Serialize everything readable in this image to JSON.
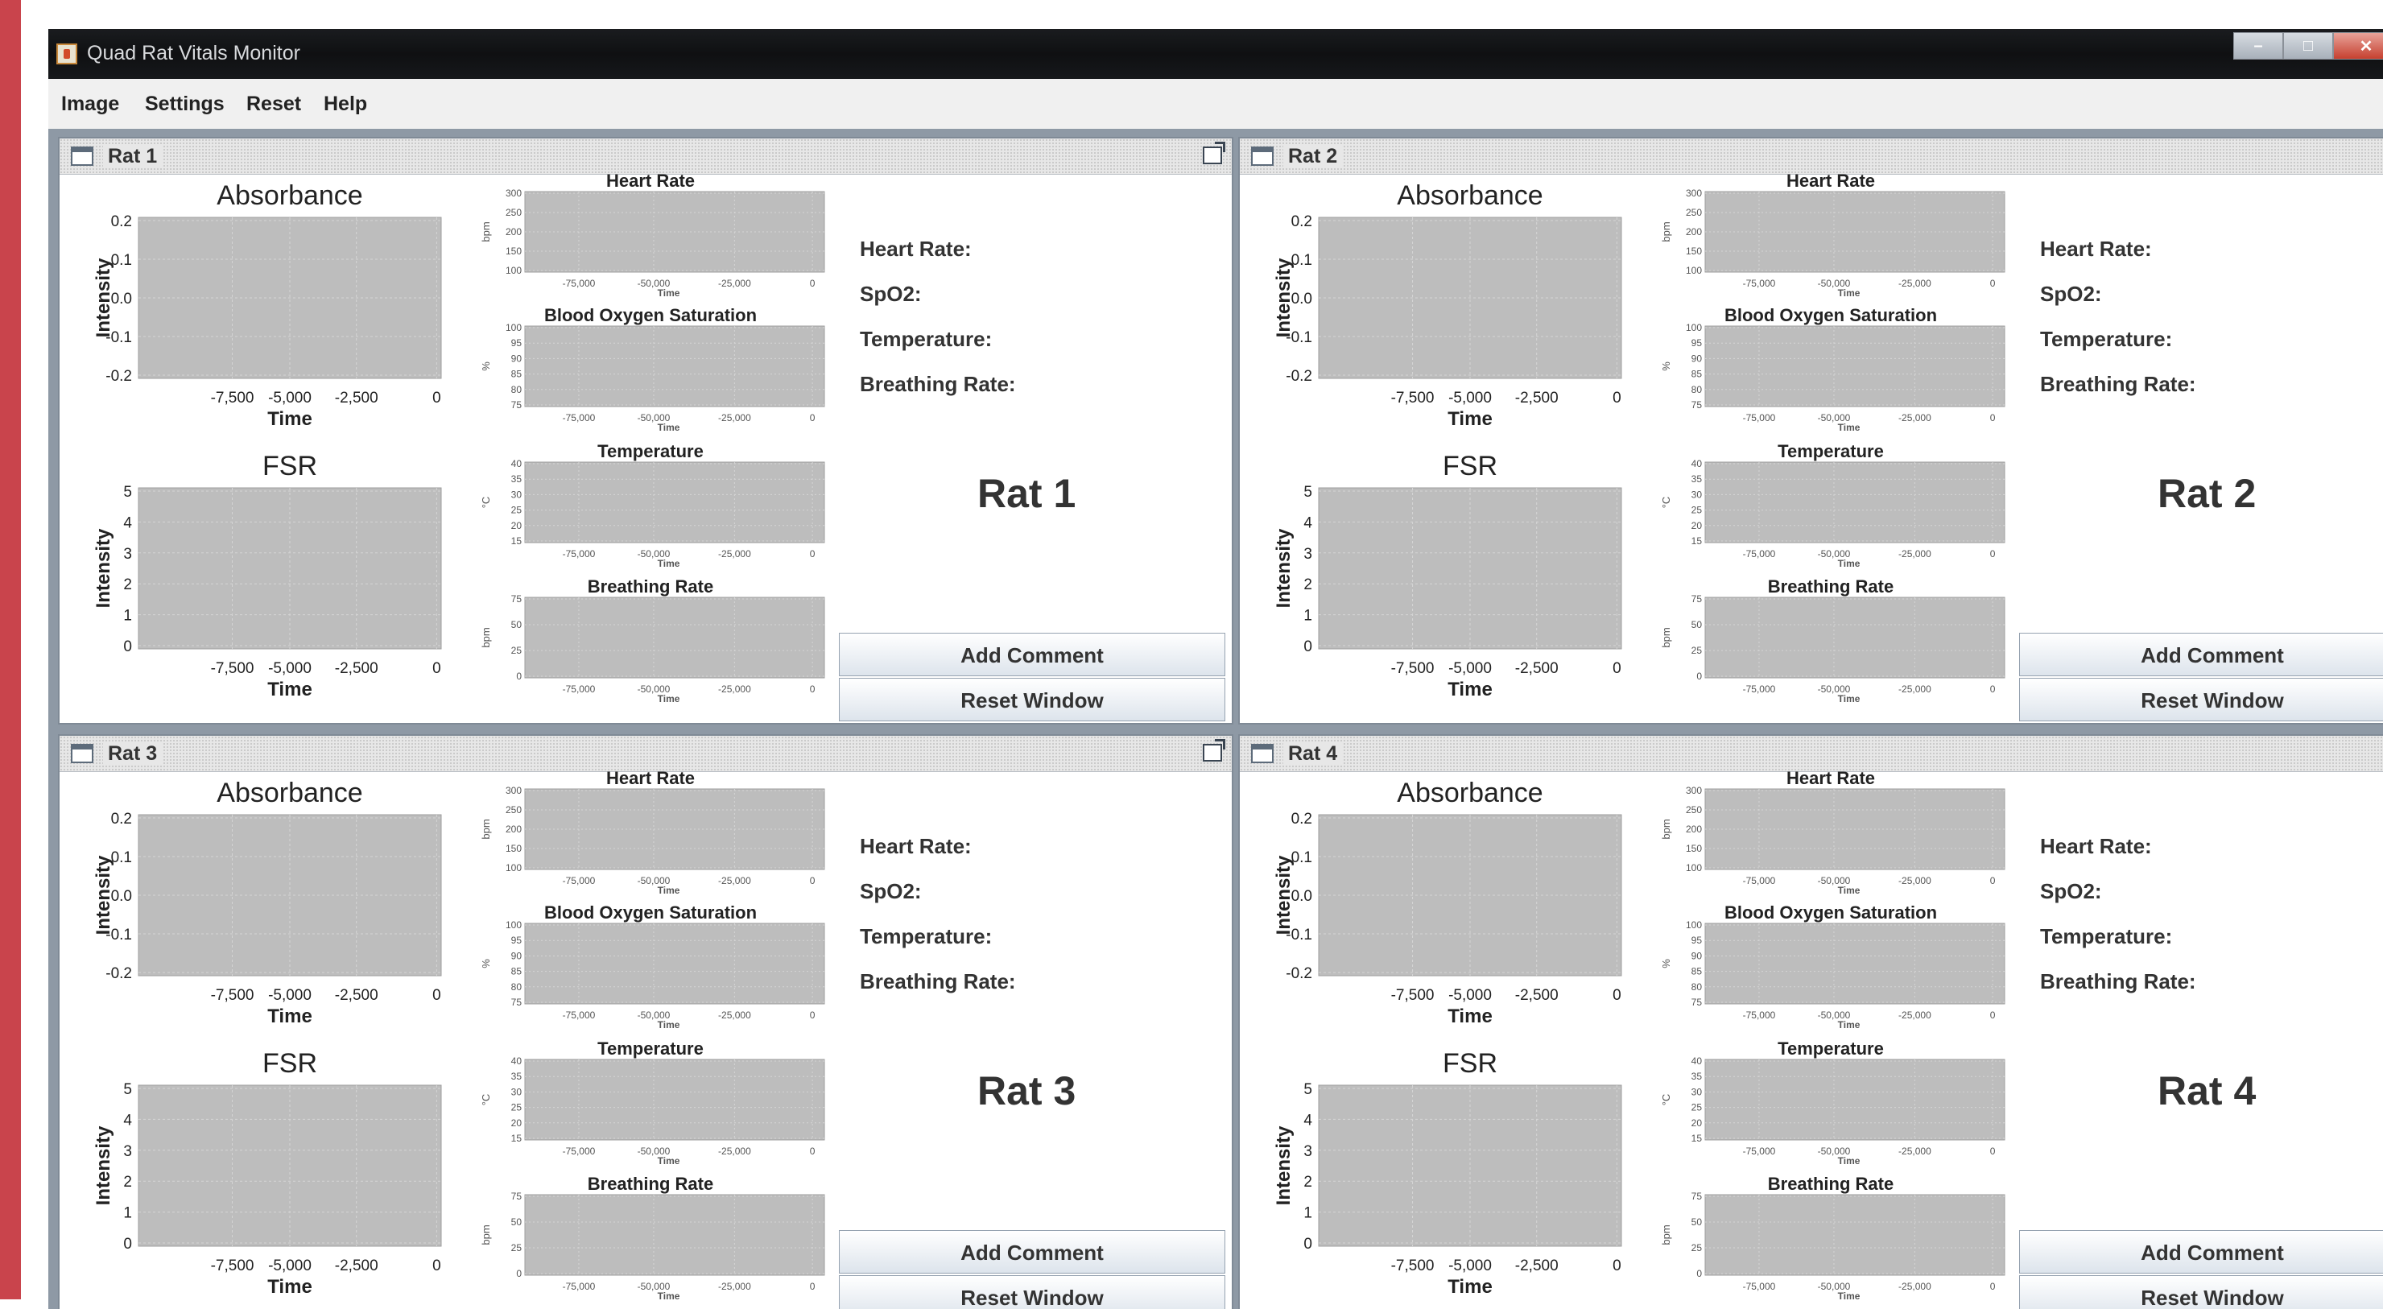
{
  "window": {
    "title": "Quad Rat Vitals Monitor"
  },
  "menu": [
    "Image",
    "Settings",
    "Reset",
    "Help"
  ],
  "panels": [
    {
      "tab": "Rat 1",
      "name": "Rat 1"
    },
    {
      "tab": "Rat 2",
      "name": "Rat 2"
    },
    {
      "tab": "Rat 3",
      "name": "Rat 3"
    },
    {
      "tab": "Rat 4",
      "name": "Rat 4"
    }
  ],
  "vitals_labels": [
    "Heart Rate:",
    "SpO2:",
    "Temperature:",
    "Breathing Rate:"
  ],
  "buttons": {
    "add_comment": "Add Comment",
    "reset_window": "Reset Window"
  },
  "colors": {
    "plot_bg": "#bdbdbd",
    "grid": "#d5d5d5",
    "desktop": "#8e99a5",
    "titlebar": "#131517"
  },
  "chart_data": {
    "absorbance": {
      "type": "line",
      "title": "Absorbance",
      "xlabel": "Time",
      "ylabel": "Intensity",
      "xticks": [
        "-7,500",
        "-5,000",
        "-2,500",
        "0"
      ],
      "yticks": [
        "0.2",
        "0.1",
        "0.0",
        "-0.1",
        "-0.2"
      ],
      "ylim": [
        -0.2,
        0.2
      ],
      "series": []
    },
    "fsr": {
      "type": "line",
      "title": "FSR",
      "xlabel": "Time",
      "ylabel": "Intensity",
      "xticks": [
        "-7,500",
        "-5,000",
        "-2,500",
        "0"
      ],
      "yticks": [
        "5",
        "4",
        "3",
        "2",
        "1",
        "0"
      ],
      "ylim": [
        0,
        5
      ],
      "series": []
    },
    "heart_rate": {
      "type": "line",
      "title": "Heart Rate",
      "xlabel": "Time",
      "ylabel": "bpm",
      "xticks": [
        "-75,000",
        "-50,000",
        "-25,000",
        "0"
      ],
      "yticks": [
        "300",
        "250",
        "200",
        "150",
        "100"
      ],
      "ylim": [
        100,
        300
      ],
      "series": []
    },
    "spo2": {
      "type": "line",
      "title": "Blood Oxygen Saturation",
      "xlabel": "Time",
      "ylabel": "%",
      "xticks": [
        "-75,000",
        "-50,000",
        "-25,000",
        "0"
      ],
      "yticks": [
        "100",
        "95",
        "90",
        "85",
        "80",
        "75"
      ],
      "ylim": [
        75,
        100
      ],
      "series": []
    },
    "temperature": {
      "type": "line",
      "title": "Temperature",
      "xlabel": "Time",
      "ylabel": "°C",
      "xticks": [
        "-75,000",
        "-50,000",
        "-25,000",
        "0"
      ],
      "yticks": [
        "40",
        "35",
        "30",
        "25",
        "20",
        "15"
      ],
      "ylim": [
        15,
        40
      ],
      "series": []
    },
    "breathing_rate": {
      "type": "line",
      "title": "Breathing Rate",
      "xlabel": "Time",
      "ylabel": "bpm",
      "xticks": [
        "-75,000",
        "-50,000",
        "-25,000",
        "0"
      ],
      "yticks": [
        "75",
        "50",
        "25",
        "0"
      ],
      "ylim": [
        0,
        75
      ],
      "series": []
    }
  }
}
